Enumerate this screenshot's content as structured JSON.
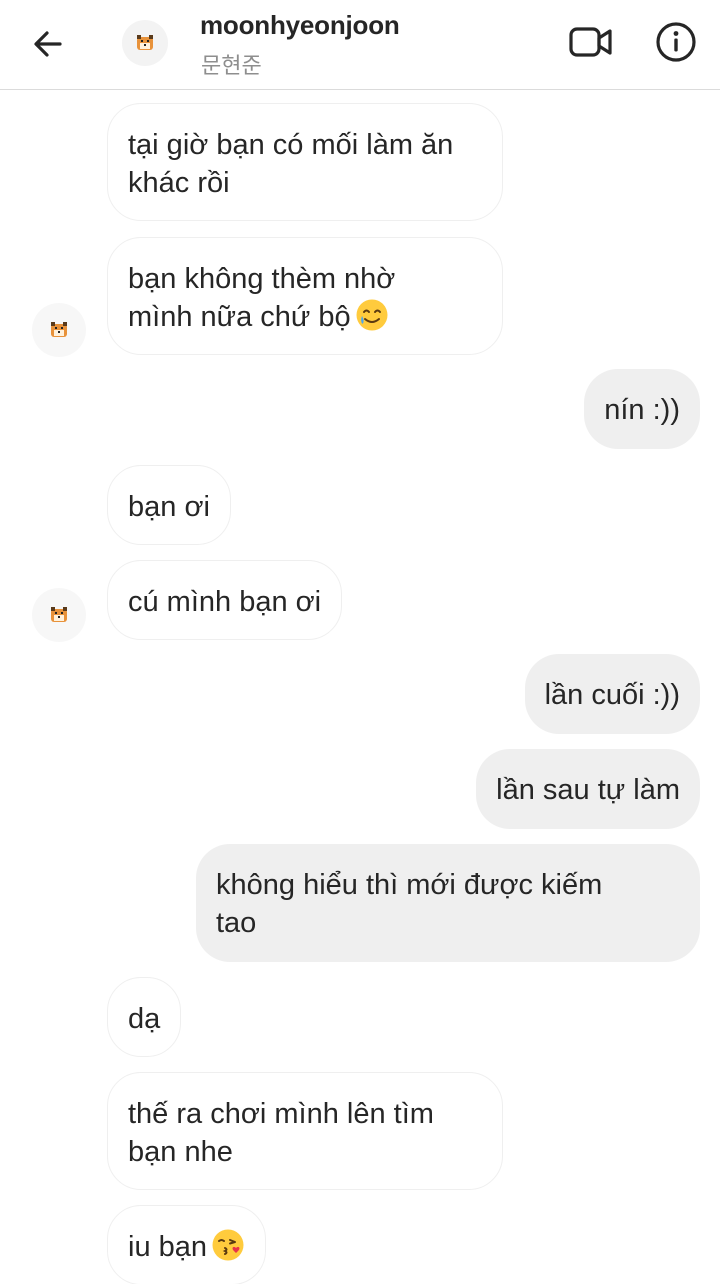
{
  "header": {
    "username": "moonhyeonjoon",
    "subname": "문현준",
    "back_icon": "arrow-left-icon",
    "video_icon": "video-camera-icon",
    "info_icon": "info-circle-icon"
  },
  "messages": [
    {
      "side": "in",
      "line1": "tại giờ bạn có mối làm ăn",
      "line2": "khác rồi"
    },
    {
      "side": "in",
      "line1": "bạn không thèm nhờ",
      "line2": "mình nữa chứ bộ",
      "emoji": "smiling-face-with-tear"
    },
    {
      "side": "out",
      "text": "nín :))"
    },
    {
      "side": "in",
      "text": "bạn ơi"
    },
    {
      "side": "in",
      "text": "cú mình bạn ơi"
    },
    {
      "side": "out",
      "text": "lần cuối :))"
    },
    {
      "side": "out",
      "text": "lần sau tự làm"
    },
    {
      "side": "out",
      "line1": "không hiểu thì mới được kiếm",
      "line2": "tao"
    },
    {
      "side": "in",
      "text": "dạ"
    },
    {
      "side": "in",
      "line1": "thế ra chơi mình lên tìm",
      "line2": "bạn nhe"
    },
    {
      "side": "in",
      "text": "iu bạn",
      "emoji": "face-blowing-kiss"
    }
  ],
  "colors": {
    "outgoing_bubble": "#efefef",
    "incoming_border": "#efefef",
    "text": "#262626",
    "muted": "#8e8e8e"
  }
}
